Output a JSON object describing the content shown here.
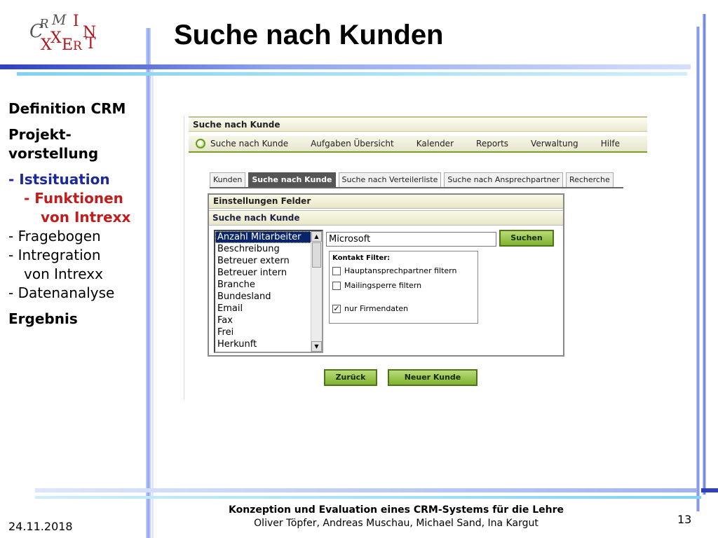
{
  "slide": {
    "title": "Suche nach Kunden",
    "page_number": "13",
    "date": "24.11.2018",
    "footer_title": "Konzeption und Evaluation eines CRM-Systems für die Lehre",
    "footer_authors": "Oliver Töpfer, Andreas Muschau, Michael Sand, Ina Kargut"
  },
  "logo": {
    "letters": [
      "C",
      "R",
      "M",
      "I",
      "N",
      "X",
      "X",
      "E",
      "R",
      "T"
    ]
  },
  "outline": {
    "item1": "Definition CRM",
    "item2_line1": "Projekt-",
    "item2_line2": "vorstellung",
    "item3": "- Istsituation",
    "item4_line1": "- Funktionen",
    "item4_line2": "von Intrexx",
    "item5": "- Fragebogen",
    "item6_line1": "- Intregration",
    "item6_line2": "von Intrexx",
    "item7": "- Datenanalyse",
    "item8": "Ergebnis"
  },
  "app": {
    "header_title": "Suche nach Kunde",
    "nav": [
      "Suche nach Kunde",
      "Aufgaben Übersicht",
      "Kalender",
      "Reports",
      "Verwaltung",
      "Hilfe"
    ],
    "tabs": [
      "Kunden",
      "Suche nach Kunde",
      "Suche nach Verteilerliste",
      "Suche nach Ansprechpartner",
      "Recherche"
    ],
    "active_tab": "Suche nach Kunde",
    "panel_title": "Einstellungen Felder",
    "panel_subtitle": "Suche nach Kunde",
    "fields": [
      "Anzahl Mitarbeiter",
      "Beschreibung",
      "Betreuer extern",
      "Betreuer intern",
      "Branche",
      "Bundesland",
      "Email",
      "Fax",
      "Frei",
      "Herkunft"
    ],
    "selected_field": "Anzahl Mitarbeiter",
    "search_value": "Microsoft",
    "search_button": "Suchen",
    "filter_title": "Kontakt Filter:",
    "filters": [
      {
        "label": "Hauptansprechpartner filtern",
        "checked": false
      },
      {
        "label": "Mailingsperre filtern",
        "checked": false
      },
      {
        "label": "nur Firmendaten",
        "checked": true
      }
    ],
    "back_button": "Zurück",
    "new_customer_button": "Neuer Kunde"
  }
}
